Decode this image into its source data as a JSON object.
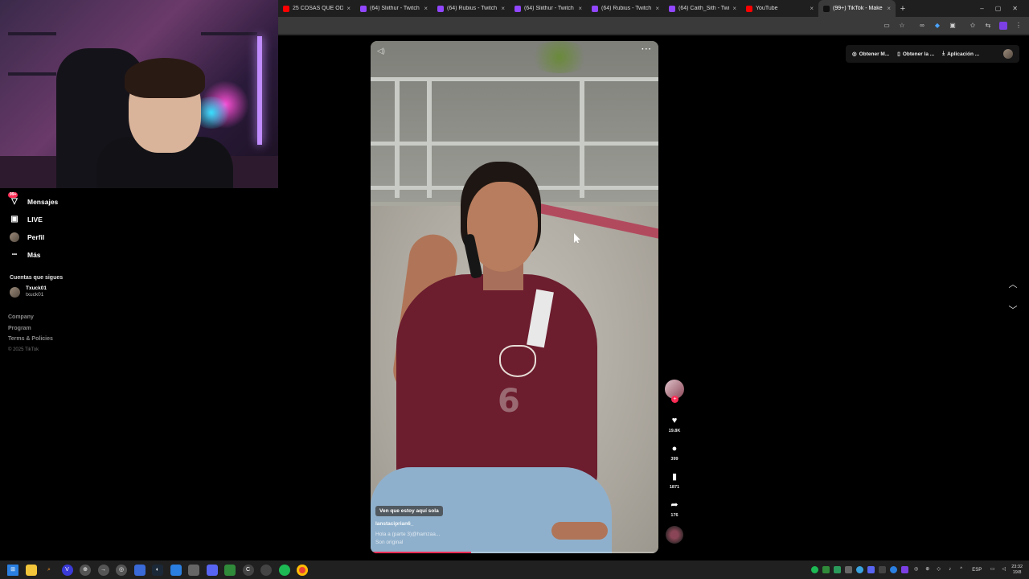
{
  "browser": {
    "tabs": [
      {
        "title": "25 COSAS QUE ODIAMOS",
        "color": "#ff0000",
        "active": false
      },
      {
        "title": "(64) Sliithur - Twitch",
        "color": "#9146ff",
        "active": false
      },
      {
        "title": "(64) Rubius - Twitch",
        "color": "#9146ff",
        "active": false
      },
      {
        "title": "(64) Sliithur - Twitch",
        "color": "#9146ff",
        "active": false
      },
      {
        "title": "(64) Rubius - Twitch",
        "color": "#9146ff",
        "active": false
      },
      {
        "title": "(64) Caith_Sith - Twitch",
        "color": "#9146ff",
        "active": false
      },
      {
        "title": "YouTube",
        "color": "#ff0000",
        "active": false
      },
      {
        "title": "(99+) TikTok - Make Your Day",
        "color": "#111111",
        "active": true
      }
    ],
    "new_tab": "+",
    "close": "×",
    "window_controls": [
      "–",
      "▢",
      "✕"
    ]
  },
  "sidebar": {
    "nav": [
      {
        "label": "Mensajes",
        "icon": "messages-icon",
        "glyph": "▽",
        "badge": "99+"
      },
      {
        "label": "LIVE",
        "icon": "live-icon",
        "glyph": "▣"
      },
      {
        "label": "Perfil",
        "icon": "profile-avatar",
        "glyph": ""
      },
      {
        "label": "Más",
        "icon": "more-icon",
        "glyph": "•••"
      }
    ],
    "following_title": "Cuentas que sigues",
    "following": [
      {
        "username": "Txuck01",
        "handle": "txuck01"
      }
    ],
    "footer": [
      "Company",
      "Program",
      "Terms & Policies"
    ],
    "copyright": "© 2025 TikTok"
  },
  "header_actions": {
    "chips": [
      "Obtener M...",
      "Obtener la ...",
      "Aplicación ..."
    ],
    "chip_icons": [
      "coin-icon",
      "phone-icon",
      "download-icon"
    ]
  },
  "video": {
    "caption_pill": "Ven que estoy aquí sola",
    "username": "lanstaciprian6_",
    "description": "Hola a (parte 3)@hamzaa...",
    "sound": "Son original",
    "progress": 0.35
  },
  "actions": {
    "likes": "19.8K",
    "comments": "399",
    "saves": "1871",
    "shares": "176"
  },
  "taskbar": {
    "lang": "ESP",
    "time": "23:32",
    "date": "19/8"
  },
  "colors": {
    "accent": "#fe2c55",
    "twitch": "#9146ff",
    "youtube": "#ff0000"
  }
}
